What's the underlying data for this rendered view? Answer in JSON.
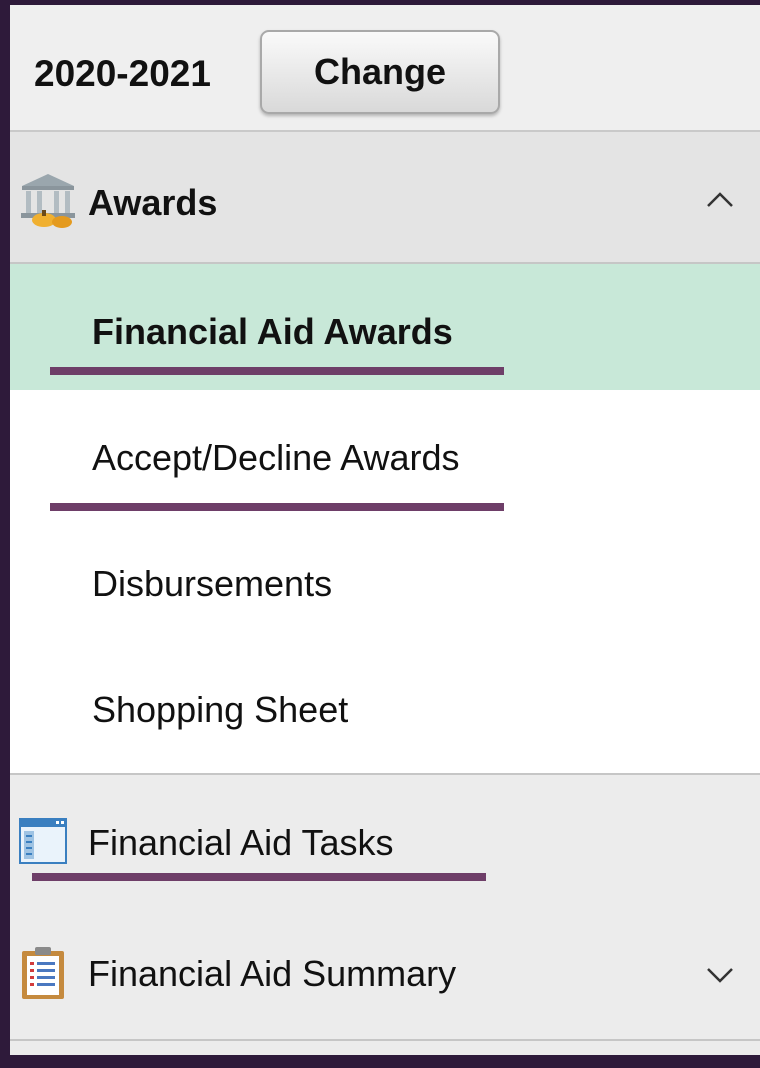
{
  "aid_year": {
    "label": "2020-2021",
    "change_button": "Change"
  },
  "sections": {
    "awards": {
      "label": "Awards",
      "expanded": true,
      "icon": "bank-icon",
      "items": [
        {
          "label": "Financial Aid Awards",
          "active": true
        },
        {
          "label": "Accept/Decline Awards",
          "active": false
        },
        {
          "label": "Disbursements",
          "active": false
        },
        {
          "label": "Shopping Sheet",
          "active": false
        }
      ]
    },
    "tasks": {
      "label": "Financial Aid Tasks",
      "icon": "window-list-icon"
    },
    "summary": {
      "label": "Financial Aid Summary",
      "expanded": false,
      "icon": "clipboard-icon"
    }
  },
  "colors": {
    "frame": "#2e1a3a",
    "active_item": "#c8e8d8",
    "highlight_underline": "#6e3e68"
  }
}
